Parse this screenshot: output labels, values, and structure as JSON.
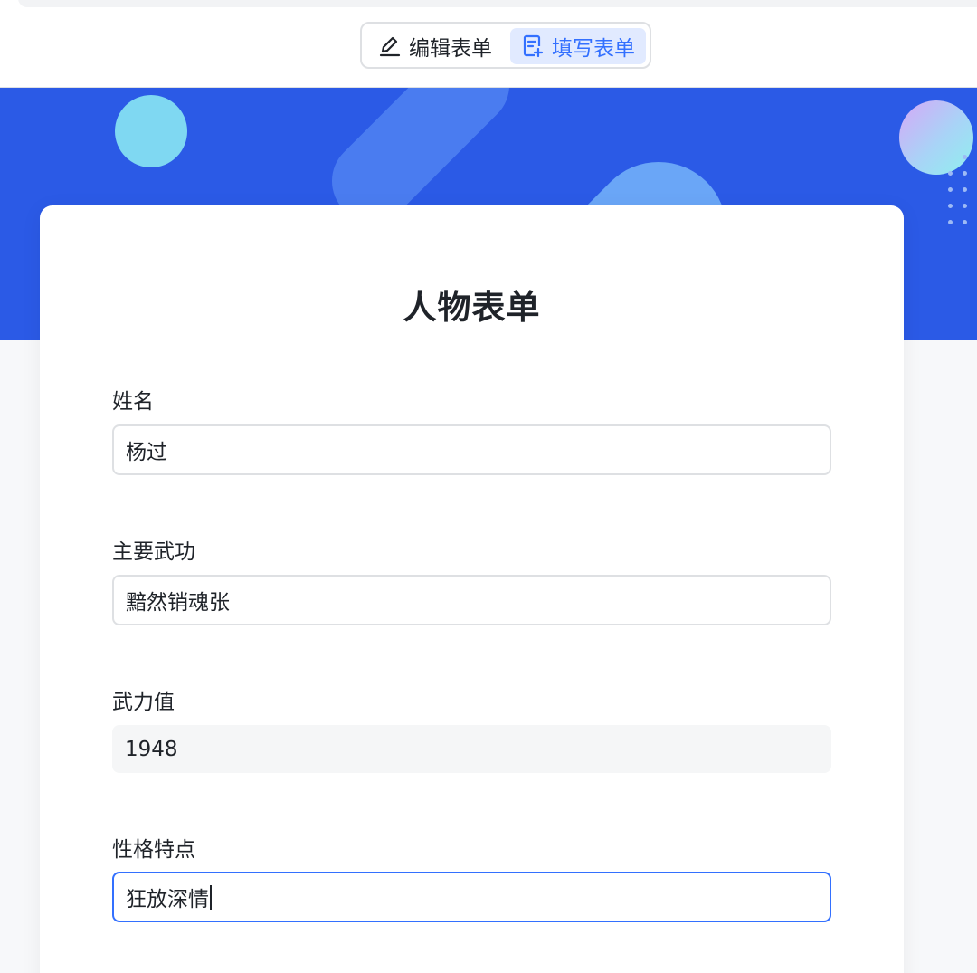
{
  "toolbar": {
    "edit_label": "编辑表单",
    "fill_label": "填写表单",
    "edit_icon": "pencil-icon",
    "fill_icon": "form-fill-icon",
    "active_mode": "fill"
  },
  "colors": {
    "banner": "#2b5ae6",
    "accent": "#3370ff",
    "active_tab_bg": "#e1eaff"
  },
  "form": {
    "title": "人物表单",
    "fields": [
      {
        "label": "姓名",
        "value": "杨过"
      },
      {
        "label": "主要武功",
        "value": "黯然销魂张"
      },
      {
        "label": "武力值",
        "value": "1948"
      },
      {
        "label": "性格特点",
        "value": "狂放深情"
      }
    ]
  }
}
